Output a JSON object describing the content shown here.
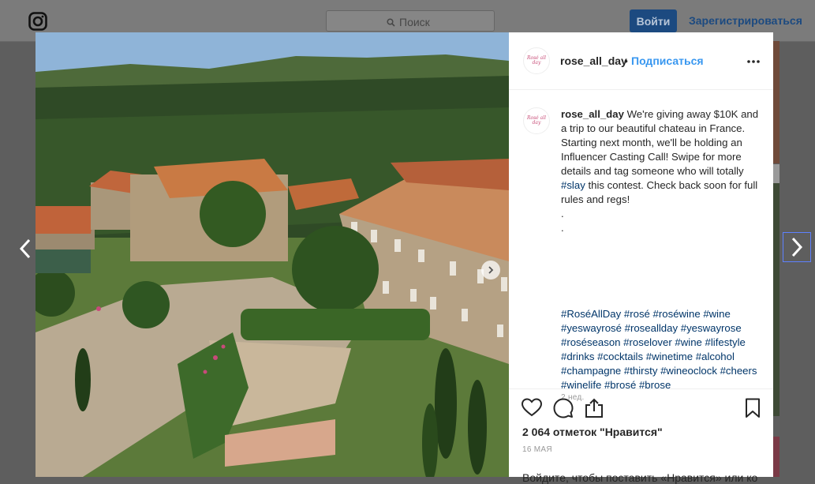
{
  "nav": {
    "logo_icon": "instagram-icon",
    "search_placeholder": "Поиск",
    "login_label": "Войти",
    "signup_label": "Зарегистрироваться"
  },
  "post": {
    "username": "rose_all_day",
    "follow_label": "Подписаться",
    "separator": "•",
    "avatar_text": "Rosé all day",
    "caption": "We're giving away $10K and a trip to our beautiful chateau in France. Starting next month, we'll be holding an Influencer Casting Call! Swipe for more details and tag someone who will totally ",
    "caption_tag": "#slay",
    "caption_end": " this contest. Check back soon for full rules and regs!\n.\n.",
    "hashtags": "#RoséAllDay #rosé #roséwine #wine #yeswayrosé #roseallday #yeswayrose #roséseason #roselover #wine #lifestyle #drinks #cocktails #winetime #alcohol #champagne #thirsty #wineoclock #cheers #winelife #brosé #brose",
    "time_ago": "2 нед.",
    "likes": "2 064 отметок \"Нравится\"",
    "date": "16 МАЯ",
    "login_prompt": "Войдите, чтобы поставить «Нравится» или ко"
  },
  "icons": {
    "like": "heart-icon",
    "comment": "comment-icon",
    "share": "share-icon",
    "save": "bookmark-icon",
    "more": "more-options-icon",
    "prev": "chevron-left-icon",
    "next": "chevron-right-icon",
    "carousel_next": "carousel-next-icon"
  },
  "colors": {
    "link": "#3897f0",
    "hashtag": "#003569",
    "login_button": "#1c4a80"
  }
}
